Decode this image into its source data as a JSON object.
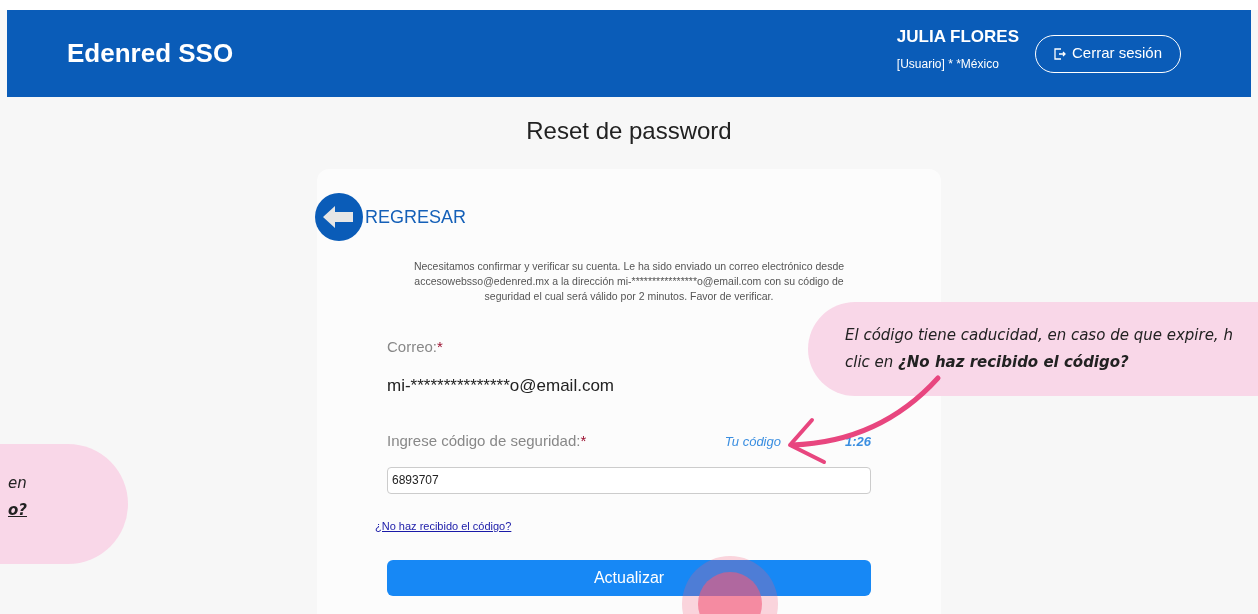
{
  "header": {
    "logo": "Edenred SSO",
    "user_name": "JULIA FLORES",
    "user_role": "[Usuario] * *México",
    "logout_button": "Cerrar sesión"
  },
  "page_title": "Reset de password",
  "back_link": "REGRESAR",
  "message": "Necesitamos confirmar y verificar su cuenta. Le ha sido enviado un correo electrónico desde accesowebsso@edenred.mx a la dirección mi-****************o@email.com con su código de seguridad el cual será válido por 2 minutos. Favor de verificar.",
  "form": {
    "email_label": "Correo:",
    "email_required": "*",
    "email_value": "mi-***************o@email.com",
    "code_label": "Ingrese código de seguridad:",
    "code_required": "*",
    "timer_start": "Tu código",
    "timer_value": "1:26",
    "code_value": "6893707",
    "resend_link": "¿No haz recibido el código?",
    "submit_button": "Actualizar"
  },
  "callouts": [
    {
      "kind": "right",
      "lines": [
        {
          "text": "El código tiene caducidad, en caso de que expire, h",
          "underline": false
        },
        {
          "text": "clic en **¿No haz recibido el código?**",
          "underline": false
        }
      ]
    },
    {
      "kind": "left",
      "lines": [
        {
          "text": "en",
          "underline": false
        },
        {
          "text": "**o?**",
          "underline": true
        }
      ]
    }
  ]
}
